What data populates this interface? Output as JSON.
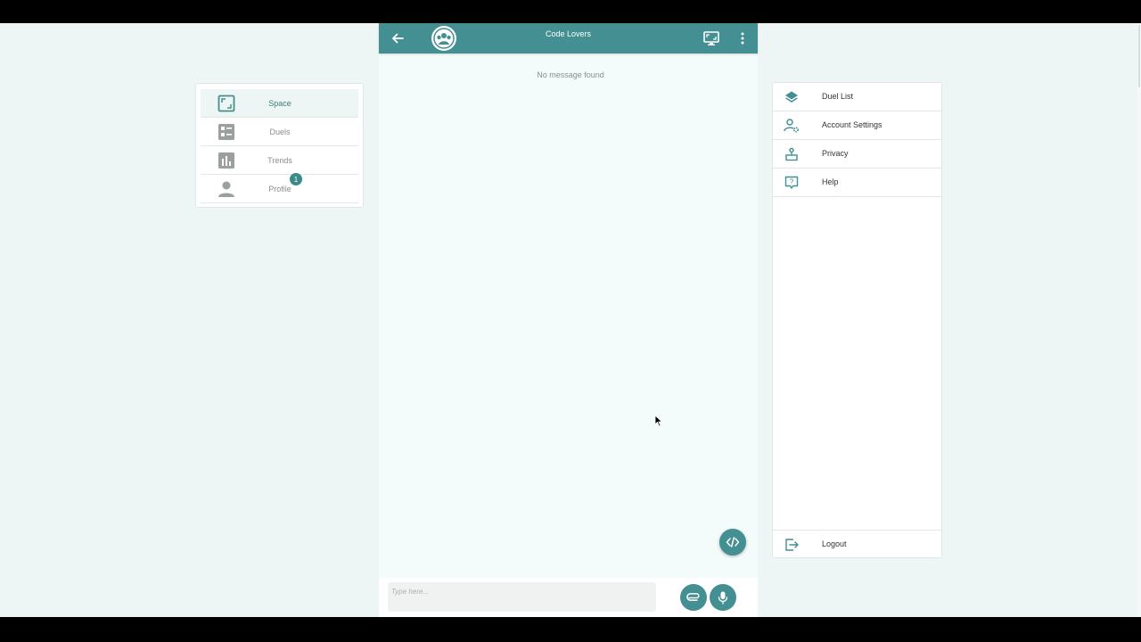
{
  "left_nav": {
    "items": [
      {
        "label": "Space",
        "icon": "crop-free-icon",
        "active": true
      },
      {
        "label": "Duels",
        "icon": "list-checks-icon",
        "active": false
      },
      {
        "label": "Trends",
        "icon": "bar-chart-icon",
        "active": false
      },
      {
        "label": "Profile",
        "icon": "person-icon",
        "active": false,
        "badge": "1"
      }
    ]
  },
  "chat": {
    "title": "Code Lovers",
    "empty_message": "No message found",
    "composer": {
      "placeholder": "Type here..."
    }
  },
  "right_menu": {
    "items": [
      {
        "label": "Duel List",
        "icon": "layers-icon"
      },
      {
        "label": "Account Settings",
        "icon": "user-cog-icon"
      },
      {
        "label": "Privacy",
        "icon": "privacy-icon"
      },
      {
        "label": "Help",
        "icon": "help-icon"
      }
    ],
    "logout_label": "Logout"
  },
  "colors": {
    "accent": "#438f91",
    "background": "#eef6f5",
    "chat_background": "#f4fcfb",
    "nav_icon_gray": "#9aa0a0"
  }
}
